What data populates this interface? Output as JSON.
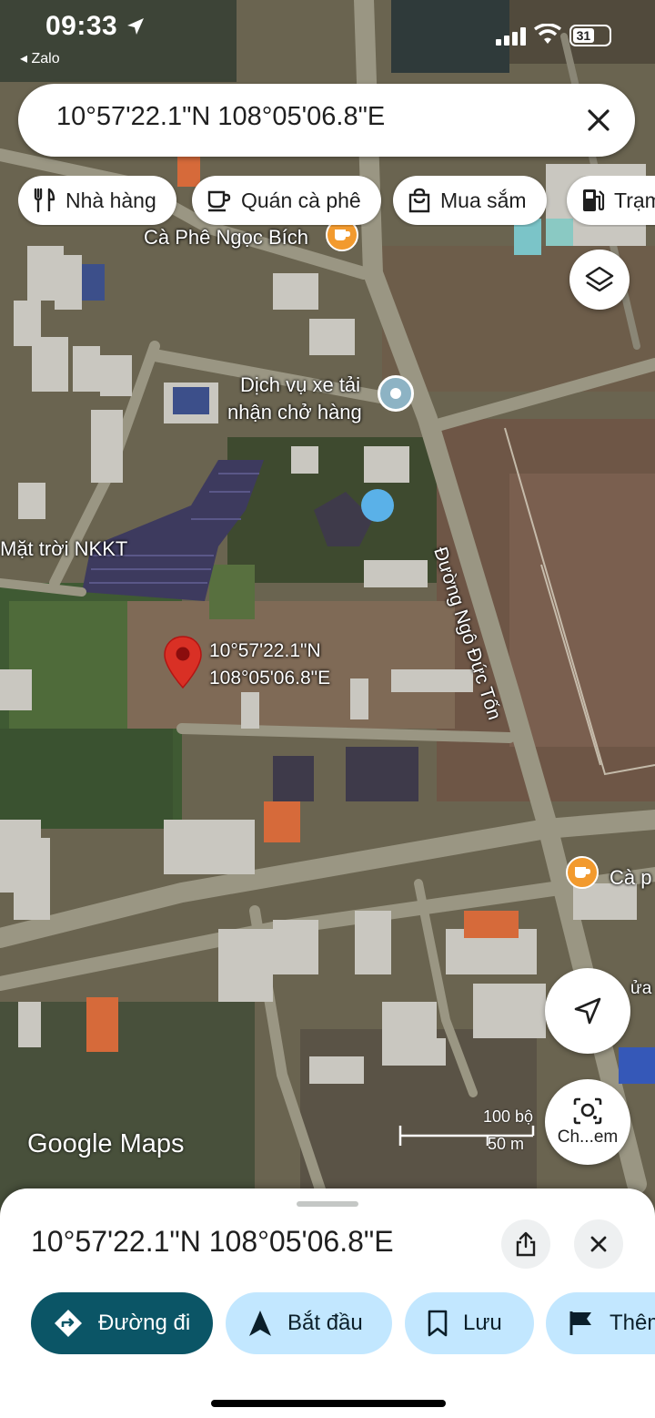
{
  "status_bar": {
    "time": "09:33",
    "back_app": "◂ Zalo",
    "battery": "31"
  },
  "search": {
    "query": "10°57'22.1\"N 108°05'06.8\"E"
  },
  "chips": [
    {
      "label": "Nhà hàng",
      "icon": "fork-knife-icon"
    },
    {
      "label": "Quán cà phê",
      "icon": "coffee-cup-icon"
    },
    {
      "label": "Mua sắm",
      "icon": "shopping-bag-icon"
    },
    {
      "label": "Trạm",
      "icon": "gas-pump-icon"
    }
  ],
  "map": {
    "labels": {
      "cafe_ngoc_bich": "Cà Phê Ngọc Bích",
      "truck_service_1": "Dịch vụ xe tải",
      "truck_service_2": "nhận chở hàng",
      "solar": "Mặt trời NKKT",
      "road": "Đường Ngô Đức Tốn",
      "cafe_right": "Cà p",
      "cafe_right2": "ửa"
    },
    "pin": {
      "line1": "10°57'22.1\"N",
      "line2": "108°05'06.8\"E",
      "color": "#d93025"
    },
    "logo": "Google Maps",
    "scale": {
      "imperial": "100 bộ",
      "metric": "50 m"
    },
    "lens_label": "Ch...em"
  },
  "sheet": {
    "title": "10°57'22.1\"N 108°05'06.8\"E",
    "actions": [
      {
        "label": "Đường đi",
        "icon": "directions-icon"
      },
      {
        "label": "Bắt đầu",
        "icon": "navigation-arrow-icon"
      },
      {
        "label": "Lưu",
        "icon": "bookmark-icon"
      },
      {
        "label": "Thêm",
        "icon": "flag-icon"
      }
    ]
  },
  "colors": {
    "primary_action": "#0b5566",
    "chip_action": "#c2e7ff",
    "poi_cafe": "#f29a2e"
  }
}
